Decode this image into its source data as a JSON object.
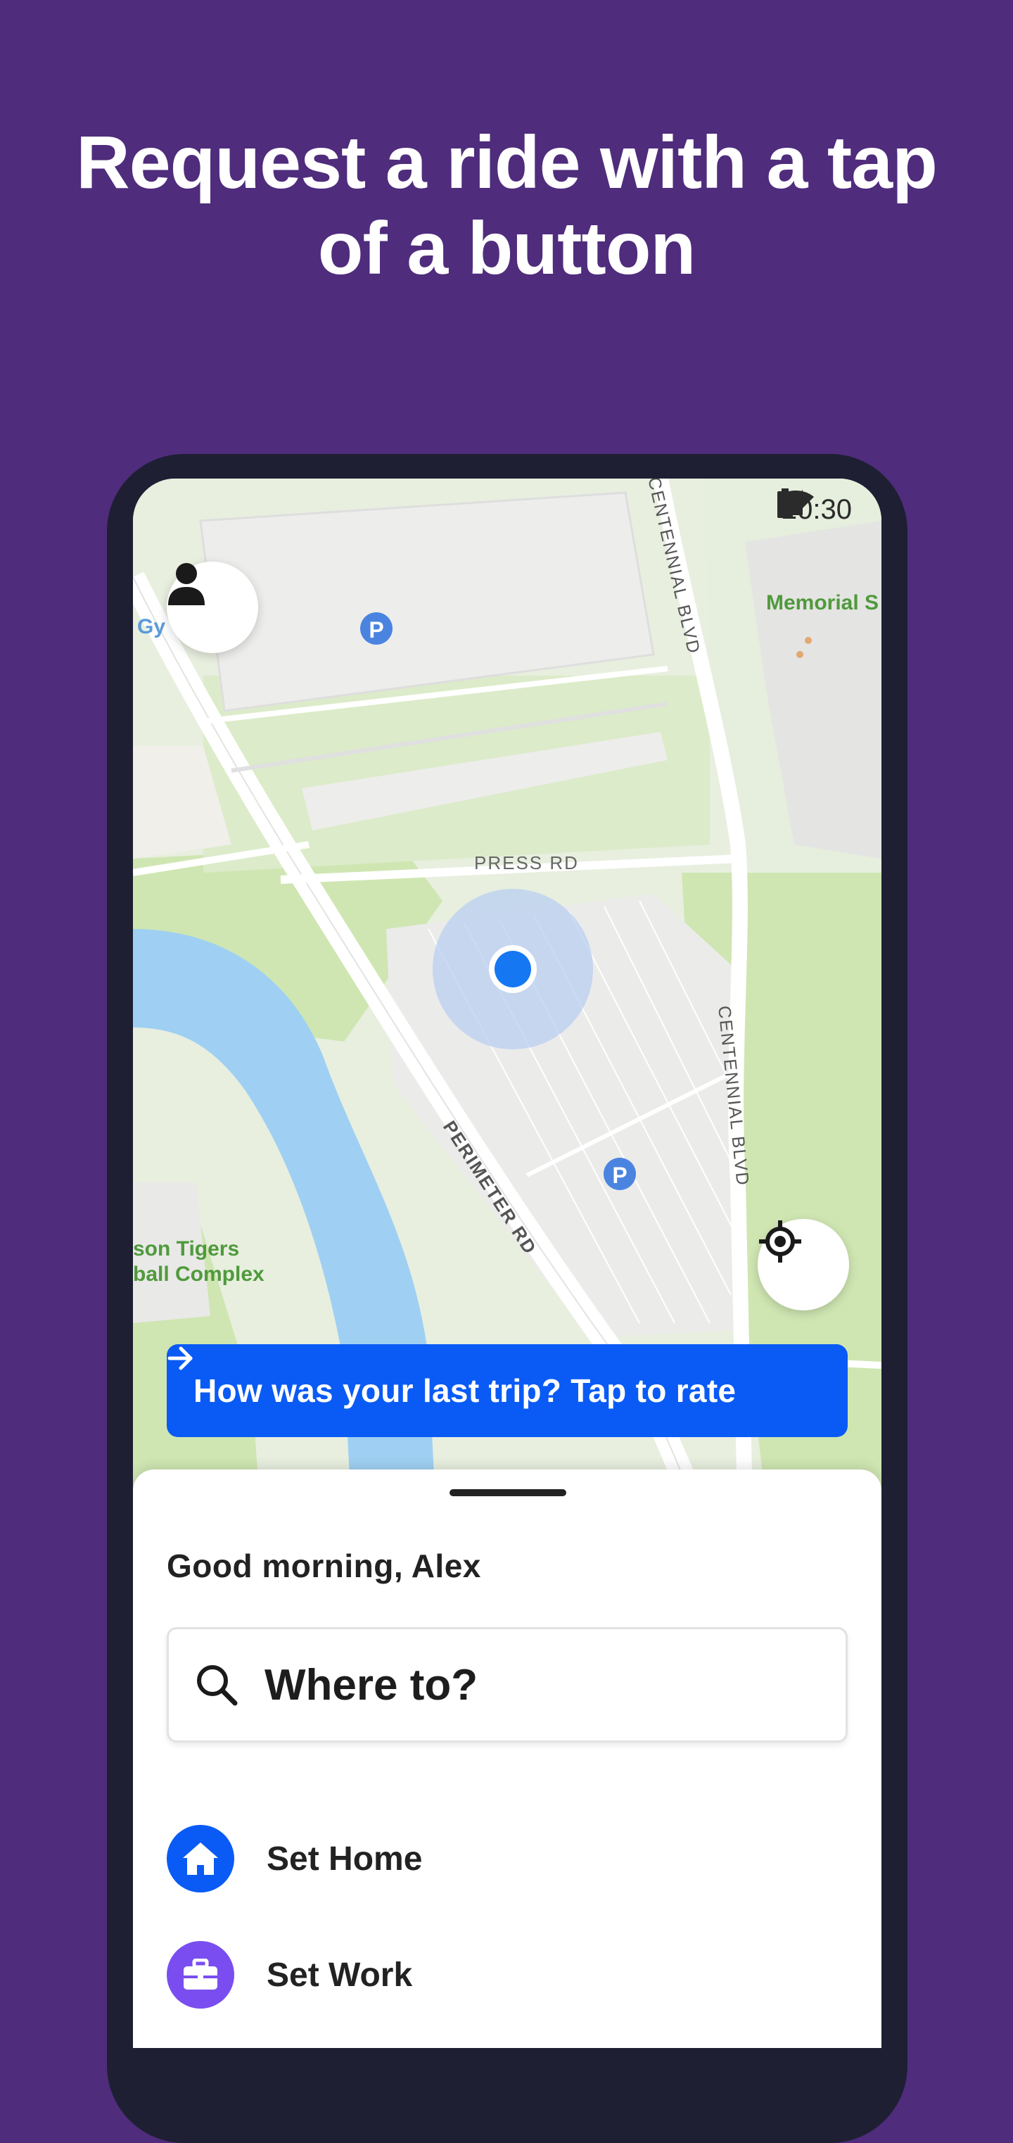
{
  "headline": {
    "line1": "Request a ride with a tap",
    "line2": "of a button"
  },
  "status_bar": {
    "time": "20:30",
    "icons": [
      "wifi-icon",
      "signal-icon",
      "battery-icon"
    ]
  },
  "map": {
    "labels": {
      "press_rd": "PRESS RD",
      "perimeter_rd": "PERIMETER RD",
      "centennial_blvd_top": "CENTENNIAL BLVD",
      "centennial_blvd_right": "CENTENNIAL BLVD",
      "memorial": "Memorial S",
      "gym": "Gy",
      "tigers_line1": "son Tigers",
      "tigers_line2": "ball Complex"
    },
    "parking_symbol": "P",
    "colors": {
      "park": "#cfe6b2",
      "water": "#9fd0f3",
      "road": "#ffffff",
      "lot": "#ececec",
      "location_dot": "#1677f2"
    }
  },
  "buttons": {
    "profile": "person-icon",
    "recenter": "crosshair-icon"
  },
  "rate_banner": {
    "text": "How was your last trip? Tap to rate",
    "icon": "arrow-right-icon",
    "color": "#0a5bf5"
  },
  "sheet": {
    "greeting": "Good morning, Alex",
    "search_placeholder": "Where to?",
    "places": [
      {
        "label": "Set Home",
        "icon": "home-icon",
        "color": "#0a5bf5"
      },
      {
        "label": "Set Work",
        "icon": "briefcase-icon",
        "color": "#7a4df0"
      }
    ]
  },
  "theme": {
    "background": "#4f2c7c",
    "phone_frame": "#1e1f33"
  }
}
